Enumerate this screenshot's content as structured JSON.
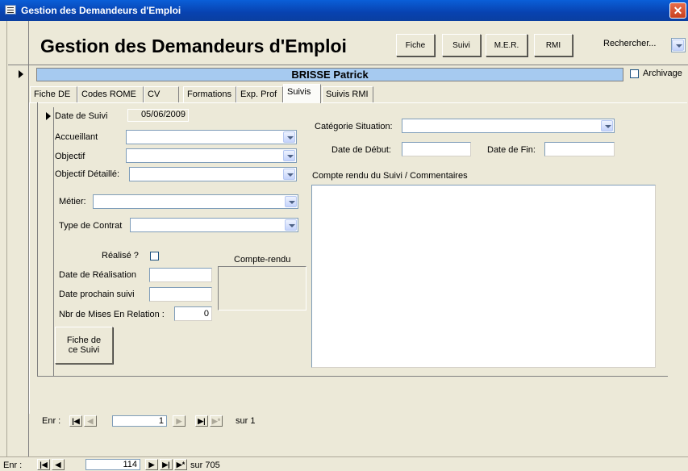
{
  "window": {
    "title": "Gestion des Demandeurs d'Emploi",
    "close_glyph": "✕"
  },
  "header": {
    "title": "Gestion des Demandeurs d'Emploi",
    "buttons": {
      "fiche": "Fiche",
      "suivi": "Suivi",
      "mer": "M.E.R.",
      "rmi": "RMI"
    },
    "search_label": "Rechercher..."
  },
  "record": {
    "name": "BRISSE Patrick",
    "archive_label": "Archivage"
  },
  "tabs": [
    "Fiche DE",
    "Codes ROME",
    "CV",
    "Formations",
    "Exp. Prof",
    "Suivis",
    "Suivis RMI"
  ],
  "suivi": {
    "date_label": "Date de Suivi",
    "date_value": "05/06/2009",
    "accueillant_label": "Accueillant",
    "objectif_label": "Objectif",
    "objectif_detaille_label": "Objectif Détaillé:",
    "metier_label": "Métier:",
    "type_contrat_label": "Type de Contrat",
    "realise_label": "Réalisé ?",
    "date_realisation_label": "Date de Réalisation",
    "date_prochain_label": "Date prochain suivi",
    "nbr_mises_label": "Nbr de Mises En Relation :",
    "nbr_mises_value": "0",
    "compte_rendu_box_label": "Compte-rendu",
    "fiche_suivi_line1": "Fiche de",
    "fiche_suivi_line2": "ce Suivi",
    "categorie_label": "Catégorie Situation:",
    "date_debut_label": "Date de Début:",
    "date_fin_label": "Date de Fin:",
    "commentaires_label": "Compte rendu du Suivi / Commentaires"
  },
  "subnav": {
    "label": "Enr :",
    "current": "1",
    "total_text": "sur  1"
  },
  "mainnav": {
    "label": "Enr :",
    "current": "114",
    "total_text": "sur  705"
  }
}
